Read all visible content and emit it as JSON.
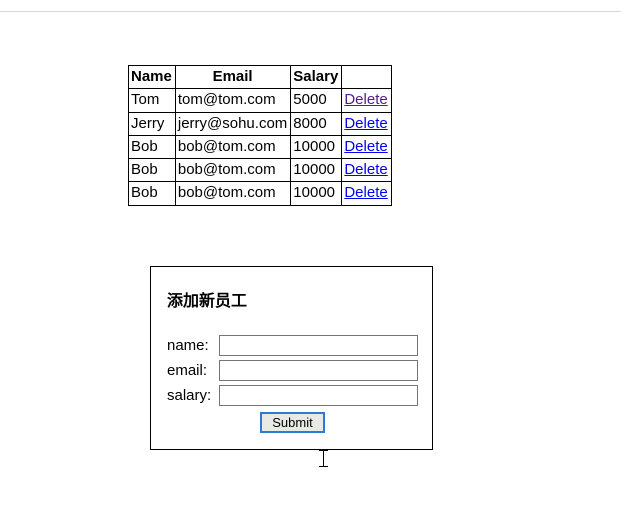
{
  "table": {
    "headers": {
      "name": "Name",
      "email": "Email",
      "salary": "Salary",
      "action": ""
    },
    "rows": [
      {
        "name": "Tom",
        "email": "tom@tom.com",
        "salary": "5000",
        "action": "Delete",
        "visited": true
      },
      {
        "name": "Jerry",
        "email": "jerry@sohu.com",
        "salary": "8000",
        "action": "Delete",
        "visited": false
      },
      {
        "name": "Bob",
        "email": "bob@tom.com",
        "salary": "10000",
        "action": "Delete",
        "visited": false
      },
      {
        "name": "Bob",
        "email": "bob@tom.com",
        "salary": "10000",
        "action": "Delete",
        "visited": false
      },
      {
        "name": "Bob",
        "email": "bob@tom.com",
        "salary": "10000",
        "action": "Delete",
        "visited": false
      }
    ]
  },
  "form": {
    "title": "添加新员工",
    "labels": {
      "name": "name:",
      "email": "email:",
      "salary": "salary:"
    },
    "values": {
      "name": "",
      "email": "",
      "salary": ""
    },
    "submit_label": "Submit"
  }
}
